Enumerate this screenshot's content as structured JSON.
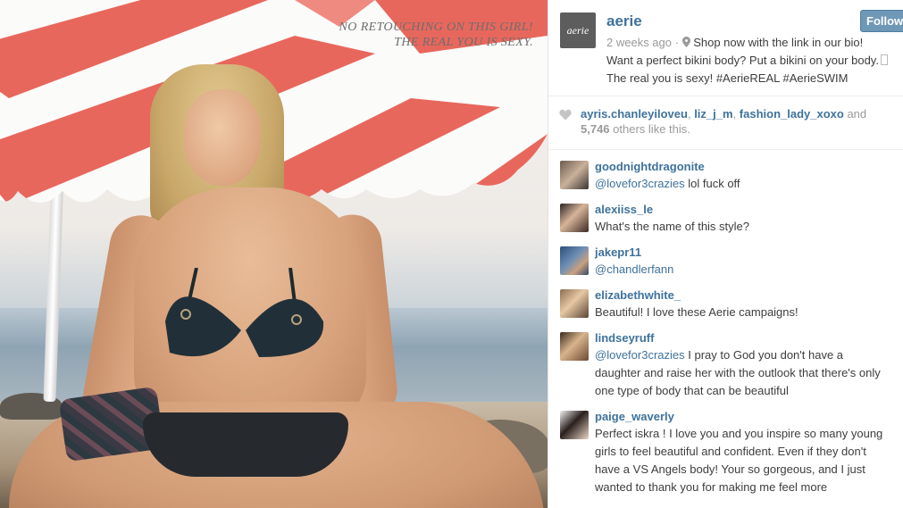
{
  "photo": {
    "caption_line1": "No retouching on this girl!",
    "caption_line2": "The real you is sexy."
  },
  "post": {
    "avatar_text": "aerie",
    "username": "aerie",
    "follow_label": "Follow",
    "time": "2 weeks ago",
    "location": "Shop now with the link in our bio!",
    "caption_line1": "Want a perfect bikini body? Put a bikini on your body.",
    "caption_line2": "The real you is sexy! #AerieREAL #AerieSWIM"
  },
  "likes": {
    "likers": [
      "ayris.chanleyiloveu",
      "liz_j_m",
      "fashion_lady_xoxo"
    ],
    "and_text": "and",
    "others_count": "5,746",
    "others_text": "others like this."
  },
  "comments": [
    {
      "user": "goodnightdragonite",
      "mention": "@lovefor3crazies",
      "text": "lol fuck off"
    },
    {
      "user": "alexiiss_le",
      "mention": "",
      "text": "What's the name of this style?"
    },
    {
      "user": "jakepr11",
      "mention": "@chandlerfann",
      "text": ""
    },
    {
      "user": "elizabethwhite_",
      "mention": "",
      "text": "Beautiful! I love these Aerie campaigns!"
    },
    {
      "user": "lindseyruff",
      "mention": "@lovefor3crazies",
      "text": "I pray to God you don't have a daughter and raise her with the outlook that there's only one type of body that can be beautiful"
    },
    {
      "user": "paige_waverly",
      "mention": "",
      "text": "Perfect iskra ! I love you and you inspire so many young girls to feel beautiful and confident. Even if they don't have a VS Angels body! Your so gorgeous, and I just wanted to thank you for making me feel more"
    }
  ],
  "colors": {
    "link": "#3f729b",
    "follow_bg": "#6f97b6",
    "umbrella_red": "#e8675c"
  },
  "icons": [
    "location-pin-icon",
    "heart-icon"
  ]
}
